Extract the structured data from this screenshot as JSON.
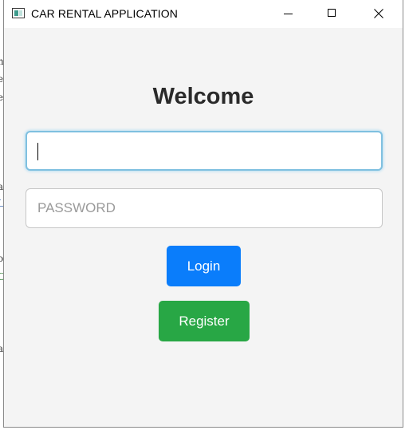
{
  "window": {
    "title": "CAR RENTAL APPLICATION",
    "icon": "app-window-icon"
  },
  "background_fragments": [
    "n",
    "e",
    "e",
    "a",
    "L",
    "o",
    "C",
    "a"
  ],
  "login": {
    "heading": "Welcome",
    "username": {
      "value": "",
      "placeholder": ""
    },
    "password": {
      "value": "",
      "placeholder": "PASSWORD"
    },
    "login_label": "Login",
    "register_label": "Register"
  },
  "colors": {
    "login_button": "#0a7dfb",
    "register_button": "#28a745",
    "focus_ring": "#7fc0e0",
    "window_background": "#f4f4f4"
  }
}
